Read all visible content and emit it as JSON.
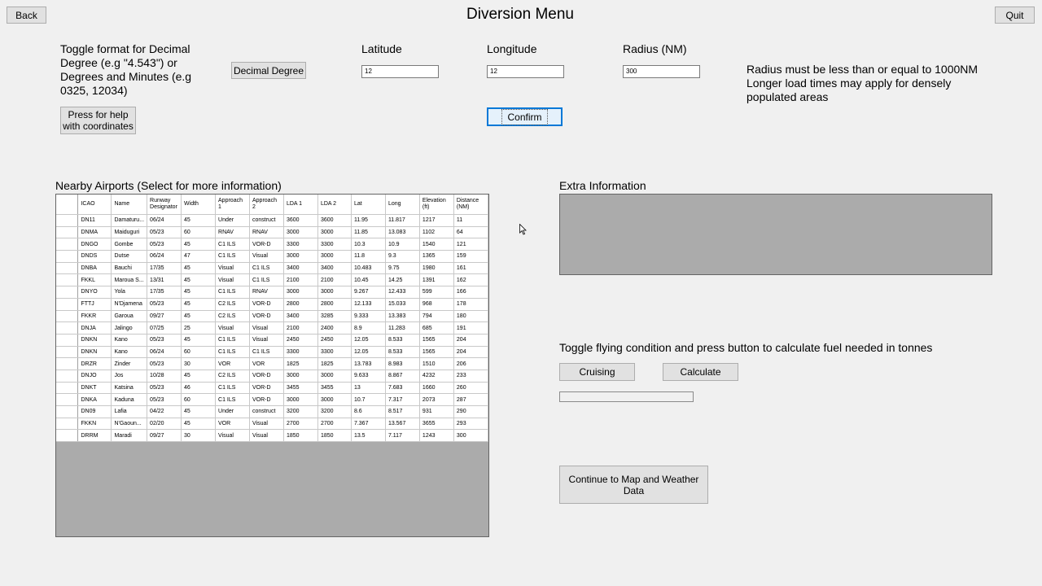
{
  "header": {
    "title": "Diversion Menu",
    "back_label": "Back",
    "quit_label": "Quit"
  },
  "coords": {
    "toggle_text_1": "Toggle format for Decimal",
    "toggle_text_2": "Degree (e.g \"4.543\") or",
    "toggle_text_3": "Degrees and Minutes (e.g",
    "toggle_text_4": "0325, 12034)",
    "format_button_label": "Decimal Degree",
    "help_button_line1": "Press for help",
    "help_button_line2": "with coordinates",
    "latitude_label": "Latitude",
    "latitude_value": "12",
    "longitude_label": "Longitude",
    "longitude_value": "12",
    "radius_label": "Radius (NM)",
    "radius_value": "300",
    "confirm_label": "Confirm",
    "note_line1": "Radius must be less than or equal to 1000NM",
    "note_line2": "Longer load times may apply for densely",
    "note_line3": "populated areas"
  },
  "airports": {
    "title": "Nearby Airports (Select for more information)",
    "columns": [
      "ICAO",
      "Name",
      "Runway Designator",
      "Width",
      "Approach 1",
      "Approach 2",
      "LDA 1",
      "LDA 2",
      "Lat",
      "Long",
      "Elevation (ft)",
      "Distance (NM)"
    ],
    "rows": [
      [
        "DN11",
        "Damaturu...",
        "06/24",
        "45",
        "Under",
        "construct",
        "3600",
        "3600",
        "11.95",
        "11.817",
        "1217",
        "11"
      ],
      [
        "DNMA",
        "Maiduguri",
        "05/23",
        "60",
        "RNAV",
        "RNAV",
        "3000",
        "3000",
        "11.85",
        "13.083",
        "1102",
        "64"
      ],
      [
        "DNGO",
        "Gombe",
        "05/23",
        "45",
        "C1 ILS",
        "VOR-D",
        "3300",
        "3300",
        "10.3",
        "10.9",
        "1540",
        "121"
      ],
      [
        "DNDS",
        "Dutse",
        "06/24",
        "47",
        "C1 ILS",
        "Visual",
        "3000",
        "3000",
        "11.8",
        "9.3",
        "1365",
        "159"
      ],
      [
        "DNBA",
        "Bauchi",
        "17/35",
        "45",
        "Visual",
        "C1 ILS",
        "3400",
        "3400",
        "10.483",
        "9.75",
        "1980",
        "161"
      ],
      [
        "FKKL",
        "Maroua S...",
        "13/31",
        "45",
        "Visual",
        "C1 ILS",
        "2100",
        "2100",
        "10.45",
        "14.25",
        "1391",
        "162"
      ],
      [
        "DNYO",
        "Yola",
        "17/35",
        "45",
        "C1 ILS",
        "RNAV",
        "3000",
        "3000",
        "9.267",
        "12.433",
        "599",
        "166"
      ],
      [
        "FTTJ",
        "N'Djamena",
        "05/23",
        "45",
        "C2 ILS",
        "VOR-D",
        "2800",
        "2800",
        "12.133",
        "15.033",
        "968",
        "178"
      ],
      [
        "FKKR",
        "Garoua",
        "09/27",
        "45",
        "C2 ILS",
        "VOR-D",
        "3400",
        "3285",
        "9.333",
        "13.383",
        "794",
        "180"
      ],
      [
        "DNJA",
        "Jalingo",
        "07/25",
        "25",
        "Visual",
        "Visual",
        "2100",
        "2400",
        "8.9",
        "11.283",
        "685",
        "191"
      ],
      [
        "DNKN",
        "Kano",
        "05/23",
        "45",
        "C1 ILS",
        "Visual",
        "2450",
        "2450",
        "12.05",
        "8.533",
        "1565",
        "204"
      ],
      [
        "DNKN",
        "Kano",
        "06/24",
        "60",
        "C1 ILS",
        "C1 ILS",
        "3300",
        "3300",
        "12.05",
        "8.533",
        "1565",
        "204"
      ],
      [
        "DRZR",
        "Zinder",
        "05/23",
        "30",
        "VOR",
        "VOR",
        "1825",
        "1825",
        "13.783",
        "8.983",
        "1510",
        "206"
      ],
      [
        "DNJO",
        "Jos",
        "10/28",
        "45",
        "C2 ILS",
        "VOR-D",
        "3000",
        "3000",
        "9.633",
        "8.867",
        "4232",
        "233"
      ],
      [
        "DNKT",
        "Katsina",
        "05/23",
        "46",
        "C1 ILS",
        "VOR-D",
        "3455",
        "3455",
        "13",
        "7.683",
        "1660",
        "260"
      ],
      [
        "DNKA",
        "Kaduna",
        "05/23",
        "60",
        "C1 ILS",
        "VOR-D",
        "3000",
        "3000",
        "10.7",
        "7.317",
        "2073",
        "287"
      ],
      [
        "DN09",
        "Lafia",
        "04/22",
        "45",
        "Under",
        "construct",
        "3200",
        "3200",
        "8.6",
        "8.517",
        "931",
        "290"
      ],
      [
        "FKKN",
        "N'Gaoun...",
        "02/20",
        "45",
        "VOR",
        "Visual",
        "2700",
        "2700",
        "7.367",
        "13.567",
        "3655",
        "293"
      ],
      [
        "DRRM",
        "Maradi",
        "09/27",
        "30",
        "Visual",
        "Visual",
        "1850",
        "1850",
        "13.5",
        "7.117",
        "1243",
        "300"
      ]
    ]
  },
  "extra": {
    "title": "Extra Information"
  },
  "fuel": {
    "instruction": "Toggle flying condition and press button to calculate fuel needed in tonnes",
    "condition_label": "Cruising",
    "calculate_label": "Calculate",
    "result_value": ""
  },
  "continue_label": "Continue to Map and Weather Data"
}
